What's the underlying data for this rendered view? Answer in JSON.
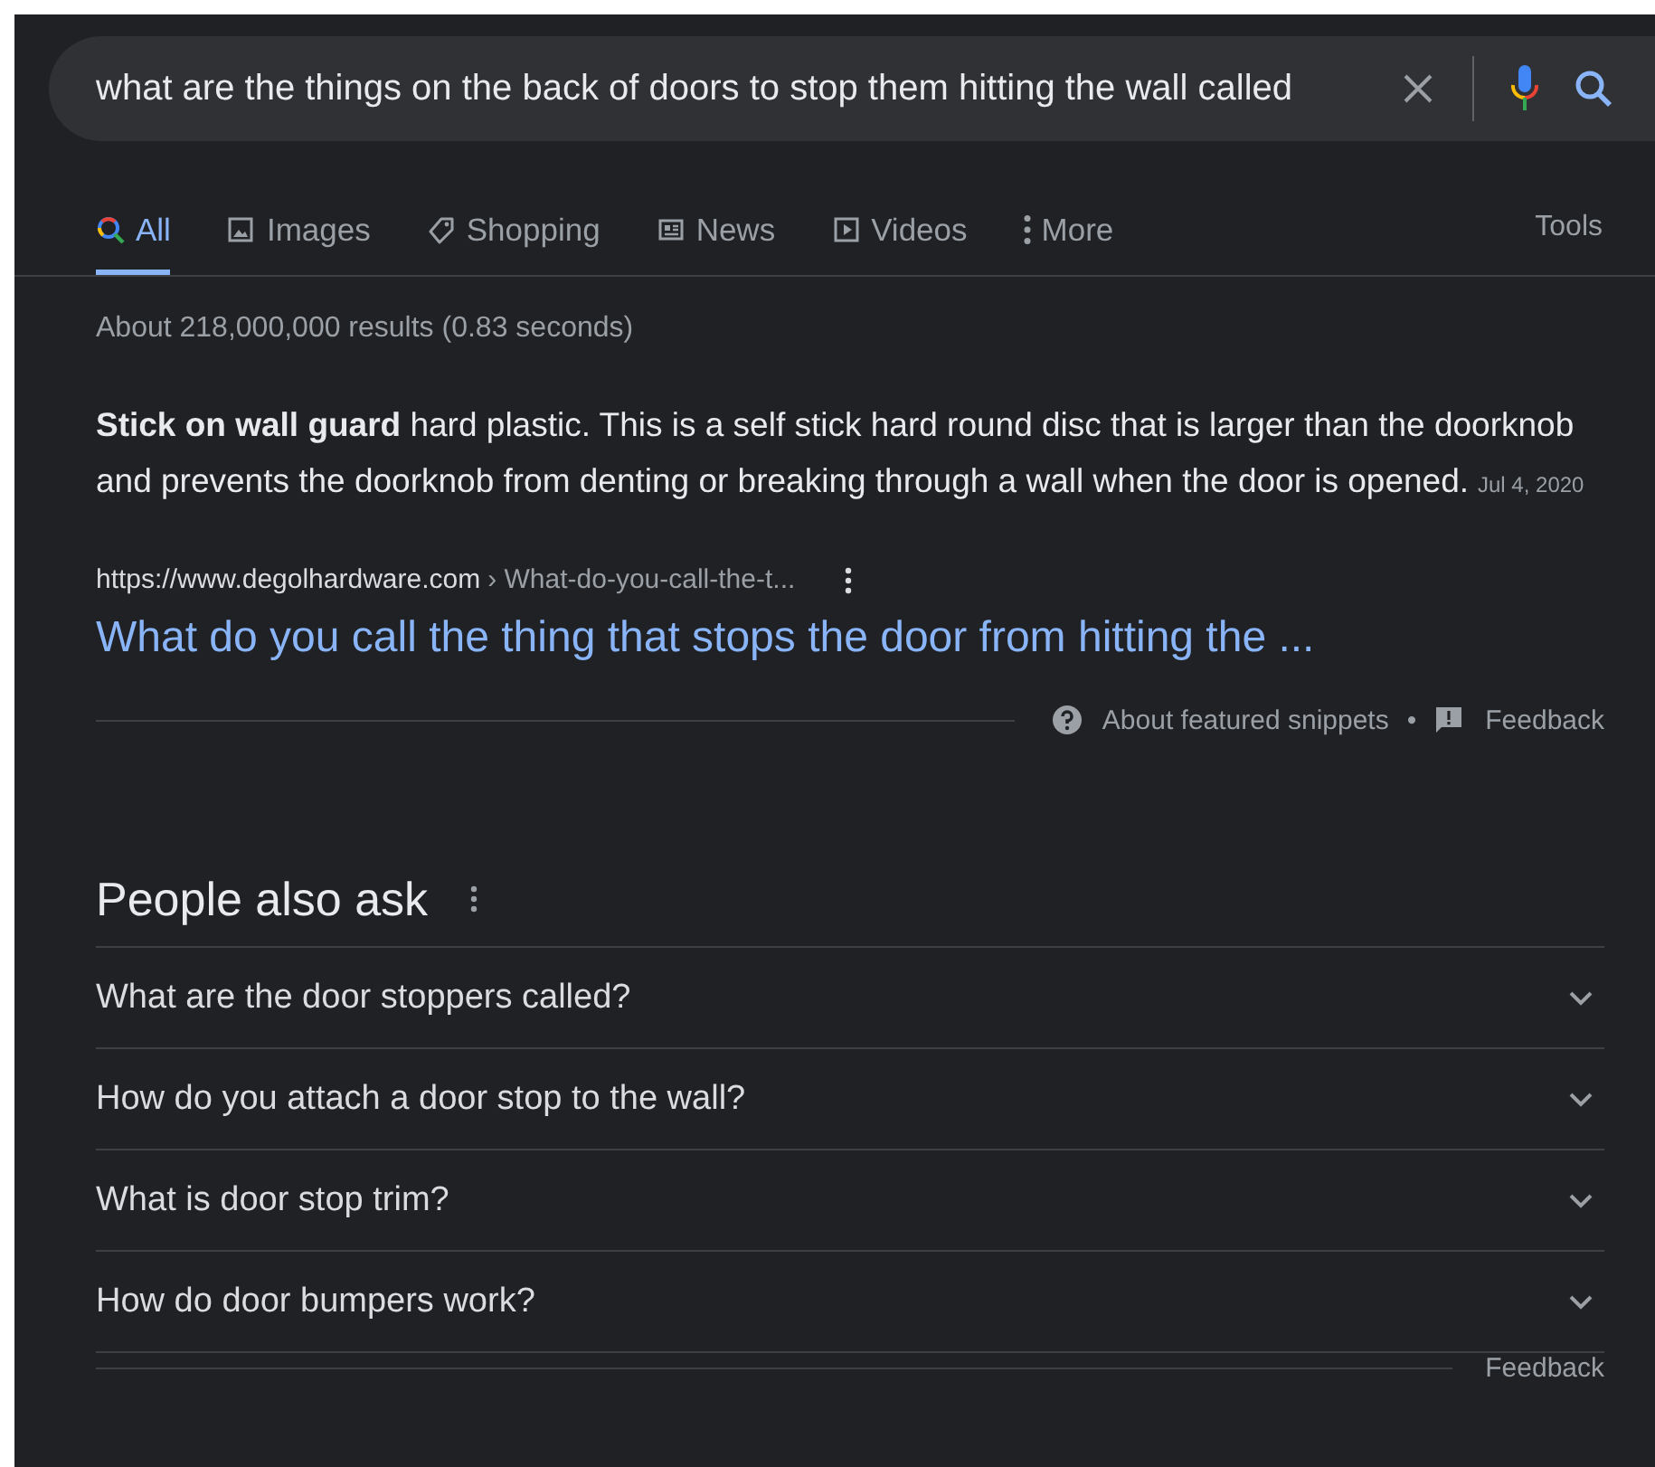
{
  "search": {
    "value": "what are the things on the back of doors to stop them hitting the wall called"
  },
  "tabs": [
    {
      "label": "All",
      "selected": true
    },
    {
      "label": "Images",
      "selected": false
    },
    {
      "label": "Shopping",
      "selected": false
    },
    {
      "label": "News",
      "selected": false
    },
    {
      "label": "Videos",
      "selected": false
    },
    {
      "label": "More",
      "selected": false
    }
  ],
  "tools": "Tools",
  "result_stats": "About 218,000,000 results (0.83 seconds)",
  "featured_snippet": {
    "text": "**Stick on wall guard** hard plastic. This is a self stick hard round disc that is larger than the doorknob and prevents the doorknob from denting or breaking through a wall when the door is opened.",
    "date": "Jul 4, 2020",
    "url": "https://www.degolhardware.com",
    "breadcrumb": "› What-do-you-call-the-t...",
    "title": "What do you call the thing that stops the door from hitting the ...",
    "about": "About featured snippets",
    "separator": "•",
    "feedback": "Feedback"
  },
  "people_also_ask": {
    "title": "People also ask",
    "questions": [
      {
        "text": "What are the door stoppers called?",
        "expanded": false
      },
      {
        "text": "How do you attach a door stop to the wall?",
        "expanded": false
      },
      {
        "text": "What is door stop trim?",
        "expanded": false
      },
      {
        "text": "How do door bumpers work?",
        "expanded": false
      }
    ],
    "feedback": "Feedback"
  }
}
